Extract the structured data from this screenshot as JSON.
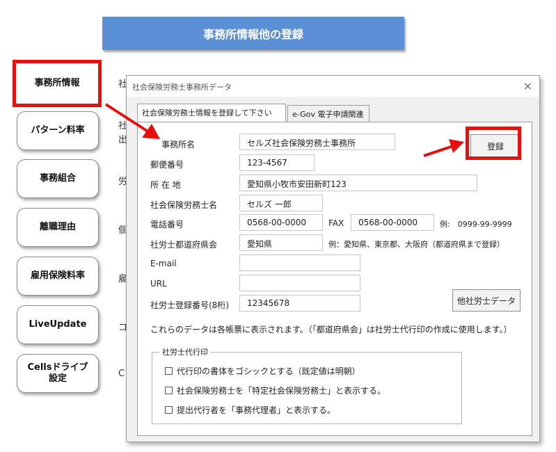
{
  "banner": {
    "title": "事務所情報他の登録"
  },
  "sidebar": {
    "items": [
      {
        "label": "事務所情報"
      },
      {
        "label": "パターン料率"
      },
      {
        "label": "事務組合"
      },
      {
        "label": "離職理由"
      },
      {
        "label": "雇用保険料率"
      },
      {
        "label": "LiveUpdate"
      },
      {
        "label": "Cellsドライブ\n設定"
      }
    ]
  },
  "peek": [
    "社",
    "社",
    "出",
    "労",
    "個",
    "雇",
    "コ",
    "C"
  ],
  "dialog": {
    "title": "社会保険労務士事務所データ",
    "close": "×",
    "tabs": [
      "社会保険労務士情報を登録して下さい",
      "e-Gov 電子申請関連"
    ],
    "register_button": "登録",
    "other_button": "他社労士データ",
    "fields": {
      "office_name": {
        "label": "事務所名",
        "value": "セルズ社会保険労務士事務所"
      },
      "postal": {
        "label": "郵便番号",
        "value": "123-4567"
      },
      "address": {
        "label": "所 在 地",
        "value": "愛知県小牧市安田新町123"
      },
      "name": {
        "label": "社会保険労務士名",
        "value": "セルズ 一郎"
      },
      "phone": {
        "label": "電話番号",
        "value": "0568-00-0000"
      },
      "fax": {
        "label": "FAX",
        "value": "0568-00-0000"
      },
      "fax_example": "例:　0999-99-9999",
      "pref": {
        "label": "社労士都道府県会",
        "value": "愛知県"
      },
      "pref_example": "例：愛知県、東京都、大阪府（都道府県まで登録）",
      "email": {
        "label": "E-mail",
        "value": ""
      },
      "url": {
        "label": "URL",
        "value": ""
      },
      "reg_no": {
        "label": "社労士登録番号(8桁)",
        "value": "12345678"
      }
    },
    "note": "これらのデータは各帳票に表示されます。（「都道府県会」は社労士代行印の作成に使用します。）",
    "stamp_group": {
      "legend": "社労士代行印",
      "options": [
        "代行印の書体をゴシックとする（既定値は明朝）",
        "社会保険労務士を「特定社会保険労務士」と表示する。",
        "提出代行者を「事務代理者」と表示する。"
      ]
    }
  },
  "colors": {
    "accent": "#5b8fd6",
    "highlight": "#e8100f"
  }
}
